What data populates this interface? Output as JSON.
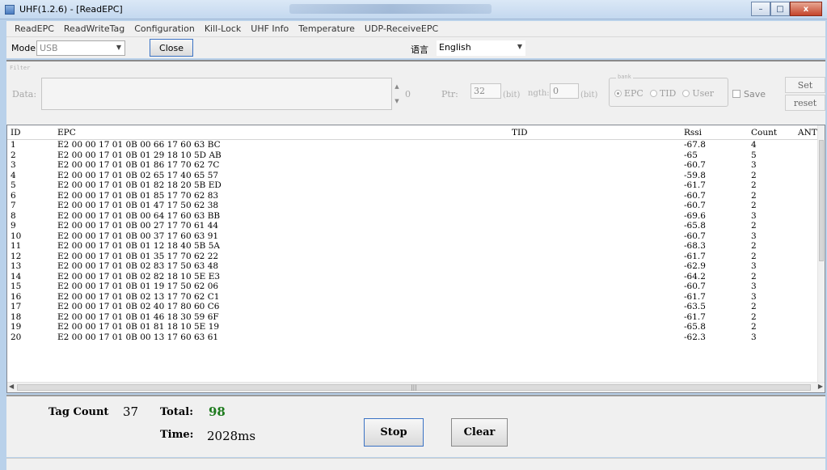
{
  "window": {
    "title": "UHF(1.2.6) - [ReadEPC]",
    "min_icon": "minimize-icon",
    "max_icon": "maximize-icon",
    "close_glyph": "x"
  },
  "menu": [
    {
      "label": "ReadEPC"
    },
    {
      "label": "ReadWriteTag"
    },
    {
      "label": "Configuration"
    },
    {
      "label": "Kill-Lock"
    },
    {
      "label": "UHF Info"
    },
    {
      "label": "Temperature"
    },
    {
      "label": "UDP-ReceiveEPC"
    }
  ],
  "toolbar": {
    "mode_label": "Mode",
    "mode_value": "USB",
    "close_label": "Close",
    "lang_label": "语言",
    "lang_value": "English"
  },
  "filter": {
    "legend": "Filter",
    "data_label": "Data:",
    "spin_value": "0",
    "ptr_label": "Ptr:",
    "ptr_value": "32",
    "ptr_unit": "(bit)",
    "length_label": "ngth:",
    "length_value": "0",
    "length_unit": "(bit)",
    "bank_legend": "bank",
    "bank_options": [
      "EPC",
      "TID",
      "User"
    ],
    "bank_selected": "EPC",
    "save_label": "Save",
    "set_label": "Set",
    "reset_label": "reset"
  },
  "table": {
    "columns": {
      "id": "ID",
      "epc": "EPC",
      "tid": "TID",
      "rssi": "Rssi",
      "count": "Count",
      "ant": "ANT"
    },
    "rows": [
      {
        "id": "1",
        "epc": "E2 00 00 17 01 0B 00 66 17 60 63 BC",
        "rssi": "-67.8",
        "count": "4"
      },
      {
        "id": "2",
        "epc": "E2 00 00 17 01 0B 01 29 18 10 5D AB",
        "rssi": "-65",
        "count": "5"
      },
      {
        "id": "3",
        "epc": "E2 00 00 17 01 0B 01 86 17 70 62 7C",
        "rssi": "-60.7",
        "count": "3"
      },
      {
        "id": "4",
        "epc": "E2 00 00 17 01 0B 02 65 17 40 65 57",
        "rssi": "-59.8",
        "count": "2"
      },
      {
        "id": "5",
        "epc": "E2 00 00 17 01 0B 01 82 18 20 5B ED",
        "rssi": "-61.7",
        "count": "2"
      },
      {
        "id": "6",
        "epc": "E2 00 00 17 01 0B 01 85 17 70 62 83",
        "rssi": "-60.7",
        "count": "2"
      },
      {
        "id": "7",
        "epc": "E2 00 00 17 01 0B 01 47 17 50 62 38",
        "rssi": "-60.7",
        "count": "2"
      },
      {
        "id": "8",
        "epc": "E2 00 00 17 01 0B 00 64 17 60 63 BB",
        "rssi": "-69.6",
        "count": "3"
      },
      {
        "id": "9",
        "epc": "E2 00 00 17 01 0B 00 27 17 70 61 44",
        "rssi": "-65.8",
        "count": "2"
      },
      {
        "id": "10",
        "epc": "E2 00 00 17 01 0B 00 37 17 60 63 91",
        "rssi": "-60.7",
        "count": "3"
      },
      {
        "id": "11",
        "epc": "E2 00 00 17 01 0B 01 12 18 40 5B 5A",
        "rssi": "-68.3",
        "count": "2"
      },
      {
        "id": "12",
        "epc": "E2 00 00 17 01 0B 01 35 17 70 62 22",
        "rssi": "-61.7",
        "count": "2"
      },
      {
        "id": "13",
        "epc": "E2 00 00 17 01 0B 02 83 17 50 63 48",
        "rssi": "-62.9",
        "count": "3"
      },
      {
        "id": "14",
        "epc": "E2 00 00 17 01 0B 02 82 18 10 5E E3",
        "rssi": "-64.2",
        "count": "2"
      },
      {
        "id": "15",
        "epc": "E2 00 00 17 01 0B 01 19 17 50 62 06",
        "rssi": "-60.7",
        "count": "3"
      },
      {
        "id": "16",
        "epc": "E2 00 00 17 01 0B 02 13 17 70 62 C1",
        "rssi": "-61.7",
        "count": "3"
      },
      {
        "id": "17",
        "epc": "E2 00 00 17 01 0B 02 40 17 80 60 C6",
        "rssi": "-63.5",
        "count": "2"
      },
      {
        "id": "18",
        "epc": "E2 00 00 17 01 0B 01 46 18 30 59 6F",
        "rssi": "-61.7",
        "count": "2"
      },
      {
        "id": "19",
        "epc": "E2 00 00 17 01 0B 01 81 18 10 5E 19",
        "rssi": "-65.8",
        "count": "2"
      },
      {
        "id": "20",
        "epc": "E2 00 00 17 01 0B 00 13 17 60 63 61",
        "rssi": "-62.3",
        "count": "3"
      }
    ]
  },
  "stats": {
    "tag_count_label": "Tag Count",
    "tag_count": "37",
    "total_label": "Total:",
    "total": "98",
    "time_label": "Time:",
    "time": "2028ms"
  },
  "actions": {
    "stop_label": "Stop",
    "clear_label": "Clear"
  }
}
